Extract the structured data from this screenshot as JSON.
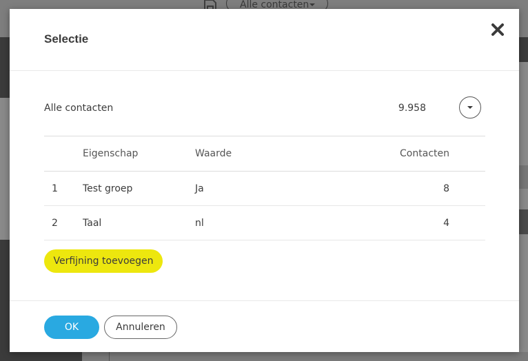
{
  "background": {
    "select_label": "Alle contacten"
  },
  "dialog": {
    "title": "Selectie",
    "summary": {
      "label": "Alle contacten",
      "count": "9.958"
    },
    "table": {
      "headers": {
        "property": "Eigenschap",
        "value": "Waarde",
        "contacts": "Contacten"
      },
      "rows": [
        {
          "index": "1",
          "property": "Test groep",
          "value": "Ja",
          "contacts": "8"
        },
        {
          "index": "2",
          "property": "Taal",
          "value": "nl",
          "contacts": "4"
        }
      ]
    },
    "add_refinement_label": "Verfijning toevoegen",
    "ok_label": "OK",
    "cancel_label": "Annuleren"
  },
  "colors": {
    "accent_blue": "#29a9e1",
    "accent_yellow": "#ede70e",
    "overlay": "#8a8a8a"
  },
  "icons": {
    "close": "close-icon",
    "expand": "chevron-down-icon",
    "save": "save-icon"
  }
}
